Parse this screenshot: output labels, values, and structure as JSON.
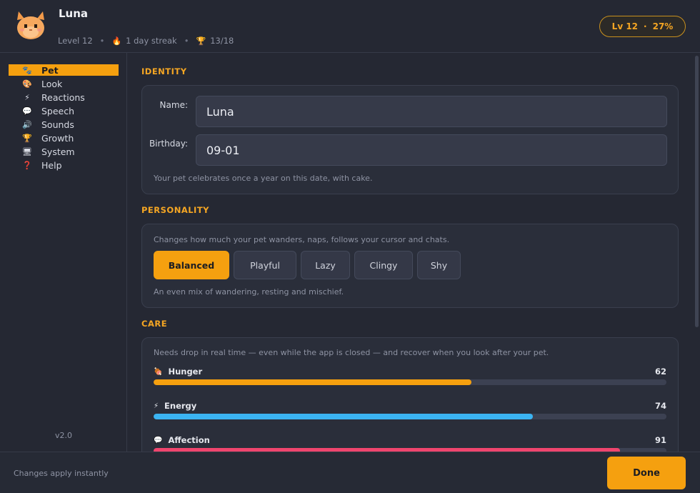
{
  "header": {
    "pet_name": "Luna",
    "level_text": "Level 12",
    "streak_text": "1 day streak",
    "trophy_text": "13/18",
    "badge_level": "Lv 12",
    "badge_separator": "·",
    "badge_progress": "27%",
    "meta_separator": "•"
  },
  "sidebar": {
    "items": [
      {
        "label": "Pet",
        "icon": "paw-icon",
        "glyph": "🐾",
        "active": true
      },
      {
        "label": "Look",
        "icon": "palette-icon",
        "glyph": "🎨",
        "active": false
      },
      {
        "label": "Reactions",
        "icon": "lightning-icon",
        "glyph": "⚡",
        "active": false
      },
      {
        "label": "Speech",
        "icon": "speech-bubble-icon",
        "glyph": "💬",
        "active": false
      },
      {
        "label": "Sounds",
        "icon": "speaker-icon",
        "glyph": "🔊",
        "active": false
      },
      {
        "label": "Growth",
        "icon": "trophy-icon",
        "glyph": "🏆",
        "active": false
      },
      {
        "label": "System",
        "icon": "monitor-icon",
        "glyph": "🖥",
        "active": false
      },
      {
        "label": "Help",
        "icon": "question-icon",
        "glyph": "❓",
        "active": false
      }
    ],
    "version": "v2.0"
  },
  "identity": {
    "title": "IDENTITY",
    "name_label": "Name:",
    "name_value": "Luna",
    "birthday_label": "Birthday:",
    "birthday_value": "09-01",
    "hint": "Your pet celebrates once a year on this date, with cake."
  },
  "personality": {
    "title": "PERSONALITY",
    "description": "Changes how much your pet wanders, naps, follows your cursor and chats.",
    "options": [
      "Balanced",
      "Playful",
      "Lazy",
      "Clingy",
      "Shy"
    ],
    "selected": "Balanced",
    "selected_hint": "An even mix of wandering, resting and mischief."
  },
  "care": {
    "title": "CARE",
    "description": "Needs drop in real time — even while the app is closed — and recover when you look after your pet.",
    "stats": [
      {
        "name": "Hunger",
        "value": 62,
        "icon": "meat-icon",
        "glyph": "🍖",
        "color": "#f5a00f"
      },
      {
        "name": "Energy",
        "value": 74,
        "icon": "lightning-icon",
        "glyph": "⚡",
        "color": "#3bb4f2"
      },
      {
        "name": "Affection",
        "value": 91,
        "icon": "heart-icon",
        "glyph": "💬",
        "color": "#f0456e"
      }
    ]
  },
  "footer": {
    "note": "Changes apply instantly",
    "done_label": "Done"
  },
  "colors": {
    "accent": "#f5a00f",
    "background": "#252833",
    "card": "#2a2e3a"
  }
}
